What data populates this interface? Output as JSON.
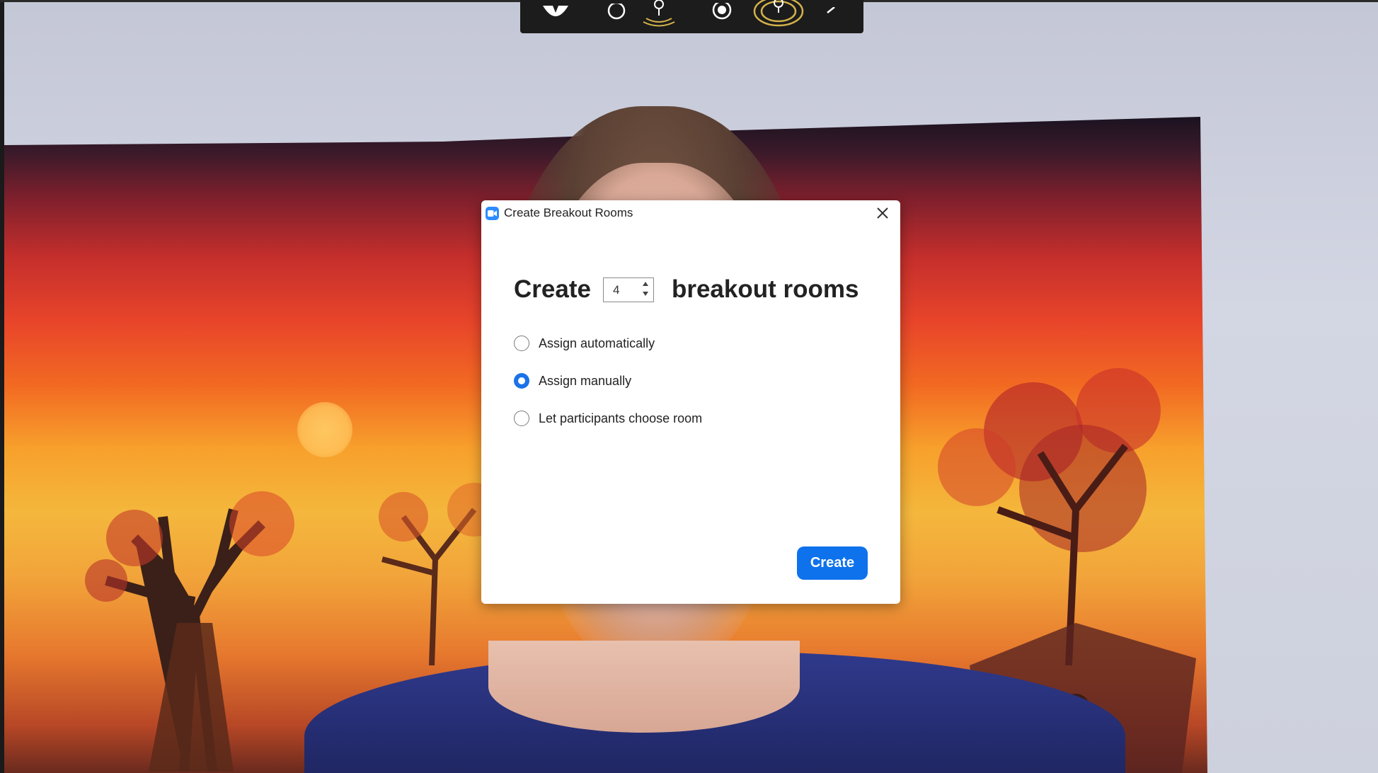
{
  "video": {
    "description_icon_names": [
      "participant-video-feed"
    ]
  },
  "toolbar": {
    "icons": [
      "share-icon",
      "circle-icon",
      "mic-icon",
      "record-icon",
      "broadcast-mic-icon",
      "chevron-left-icon"
    ]
  },
  "dialog": {
    "title": "Create Breakout Rooms",
    "headline_prefix": "Create",
    "room_count": "4",
    "headline_suffix": "breakout rooms",
    "options": [
      {
        "label": "Assign automatically",
        "checked": false
      },
      {
        "label": "Assign manually",
        "checked": true
      },
      {
        "label": "Let participants choose room",
        "checked": false
      }
    ],
    "create_label": "Create"
  },
  "colors": {
    "primary_button": "#0e72ed",
    "radio_checked": "#1a73e8",
    "app_icon": "#2d8cff"
  }
}
